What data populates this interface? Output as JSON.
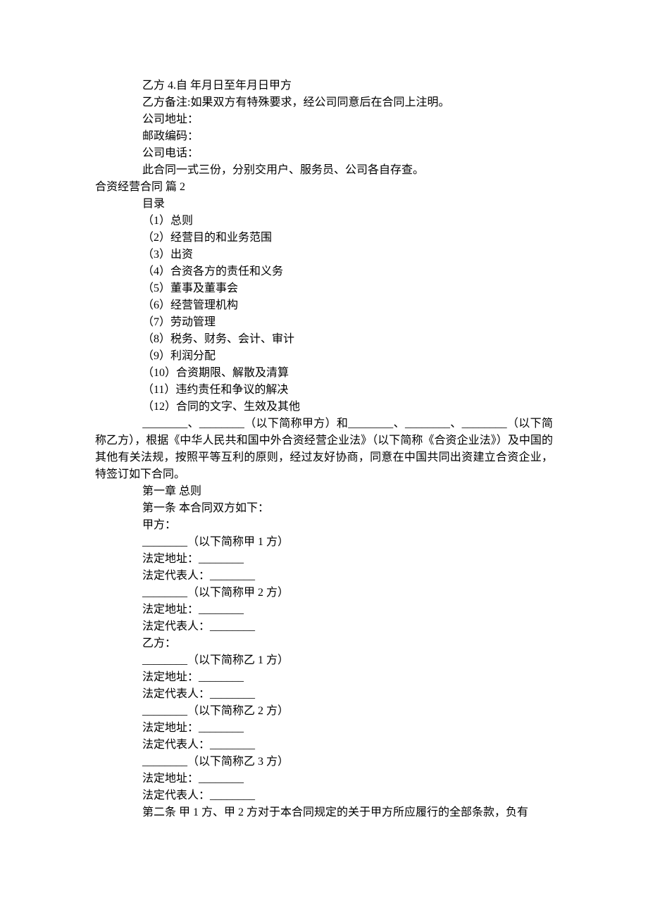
{
  "lines": {
    "l1": "乙方 4.自 年月日至年月日甲方",
    "l2": "乙方备注:如果双方有特殊要求，经公司同意后在合同上注明。",
    "l3": "公司地址：",
    "l4": "邮政编码：",
    "l5": "公司电话：",
    "l6": "此合同一式三份，分别交用户、服务员、公司各自存查。",
    "h1": "合资经营合同 篇 2",
    "l7": "目录",
    "l8": "（1）总则",
    "l9": "（2）经营目的和业务范围",
    "l10": "（3）出资",
    "l11": "（4）合资各方的责任和义务",
    "l12": "（5）董事及董事会",
    "l13": "（6）经营管理机构",
    "l14": "（7）劳动管理",
    "l15": "（8）税务、财务、会计、审计",
    "l16": "（9）利润分配",
    "l17": "（10）合资期限、解散及清算",
    "l18": "（11）违约责任和争议的解决",
    "l19": "（12）合同的文字、生效及其他",
    "l20": "________、________（以下简称甲方）和________、________、________（以下简称乙方），根据《中华人民共和国中外合资经营企业法》（以下简称《合资企业法》）及中国的其他有关法规，按照平等互利的原则，经过友好协商，同意在中国共同出资建立合资企业，特签订如下合同。",
    "l21": "第一章 总则",
    "l22": "第一条 本合同双方如下：",
    "l23": "甲方：",
    "l24": "________（以下简称甲 1 方）",
    "l25": "法定地址：________",
    "l26": "法定代表人：________",
    "l27": "________（以下简称甲 2 方）",
    "l28": "法定地址：________",
    "l29": "法定代表人：________",
    "l30": "乙方：",
    "l31": "________（以下简称乙 1 方）",
    "l32": "法定地址：________",
    "l33": "法定代表人：________",
    "l34": "________（以下简称乙 2 方）",
    "l35": "法定地址：________",
    "l36": "法定代表人：________",
    "l37": "________（以下简称乙 3 方）",
    "l38": "法定地址：________",
    "l39": "法定代表人：________",
    "l40": "第二条 甲 1 方、甲 2 方对于本合同规定的关于甲方所应履行的全部条款，负有"
  }
}
